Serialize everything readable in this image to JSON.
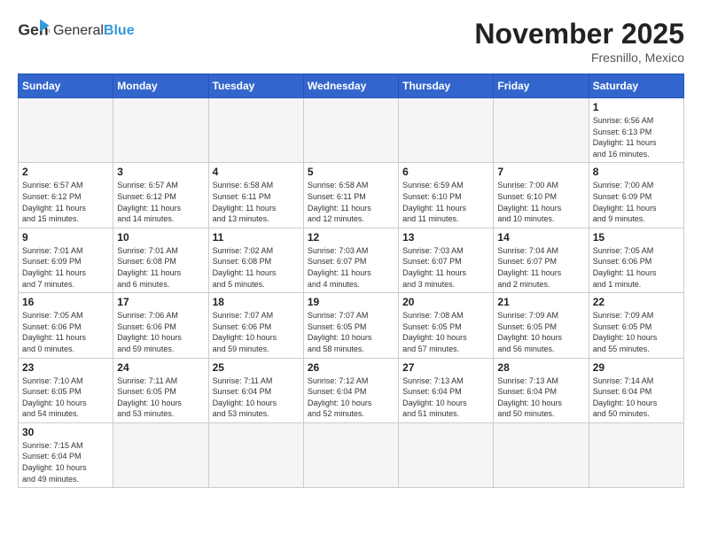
{
  "header": {
    "logo_general": "General",
    "logo_blue": "Blue",
    "month_title": "November 2025",
    "location": "Fresnillo, Mexico"
  },
  "days_of_week": [
    "Sunday",
    "Monday",
    "Tuesday",
    "Wednesday",
    "Thursday",
    "Friday",
    "Saturday"
  ],
  "weeks": [
    [
      {
        "day": "",
        "info": ""
      },
      {
        "day": "",
        "info": ""
      },
      {
        "day": "",
        "info": ""
      },
      {
        "day": "",
        "info": ""
      },
      {
        "day": "",
        "info": ""
      },
      {
        "day": "",
        "info": ""
      },
      {
        "day": "1",
        "info": "Sunrise: 6:56 AM\nSunset: 6:13 PM\nDaylight: 11 hours\nand 16 minutes."
      }
    ],
    [
      {
        "day": "2",
        "info": "Sunrise: 6:57 AM\nSunset: 6:12 PM\nDaylight: 11 hours\nand 15 minutes."
      },
      {
        "day": "3",
        "info": "Sunrise: 6:57 AM\nSunset: 6:12 PM\nDaylight: 11 hours\nand 14 minutes."
      },
      {
        "day": "4",
        "info": "Sunrise: 6:58 AM\nSunset: 6:11 PM\nDaylight: 11 hours\nand 13 minutes."
      },
      {
        "day": "5",
        "info": "Sunrise: 6:58 AM\nSunset: 6:11 PM\nDaylight: 11 hours\nand 12 minutes."
      },
      {
        "day": "6",
        "info": "Sunrise: 6:59 AM\nSunset: 6:10 PM\nDaylight: 11 hours\nand 11 minutes."
      },
      {
        "day": "7",
        "info": "Sunrise: 7:00 AM\nSunset: 6:10 PM\nDaylight: 11 hours\nand 10 minutes."
      },
      {
        "day": "8",
        "info": "Sunrise: 7:00 AM\nSunset: 6:09 PM\nDaylight: 11 hours\nand 9 minutes."
      }
    ],
    [
      {
        "day": "9",
        "info": "Sunrise: 7:01 AM\nSunset: 6:09 PM\nDaylight: 11 hours\nand 7 minutes."
      },
      {
        "day": "10",
        "info": "Sunrise: 7:01 AM\nSunset: 6:08 PM\nDaylight: 11 hours\nand 6 minutes."
      },
      {
        "day": "11",
        "info": "Sunrise: 7:02 AM\nSunset: 6:08 PM\nDaylight: 11 hours\nand 5 minutes."
      },
      {
        "day": "12",
        "info": "Sunrise: 7:03 AM\nSunset: 6:07 PM\nDaylight: 11 hours\nand 4 minutes."
      },
      {
        "day": "13",
        "info": "Sunrise: 7:03 AM\nSunset: 6:07 PM\nDaylight: 11 hours\nand 3 minutes."
      },
      {
        "day": "14",
        "info": "Sunrise: 7:04 AM\nSunset: 6:07 PM\nDaylight: 11 hours\nand 2 minutes."
      },
      {
        "day": "15",
        "info": "Sunrise: 7:05 AM\nSunset: 6:06 PM\nDaylight: 11 hours\nand 1 minute."
      }
    ],
    [
      {
        "day": "16",
        "info": "Sunrise: 7:05 AM\nSunset: 6:06 PM\nDaylight: 11 hours\nand 0 minutes."
      },
      {
        "day": "17",
        "info": "Sunrise: 7:06 AM\nSunset: 6:06 PM\nDaylight: 10 hours\nand 59 minutes."
      },
      {
        "day": "18",
        "info": "Sunrise: 7:07 AM\nSunset: 6:06 PM\nDaylight: 10 hours\nand 59 minutes."
      },
      {
        "day": "19",
        "info": "Sunrise: 7:07 AM\nSunset: 6:05 PM\nDaylight: 10 hours\nand 58 minutes."
      },
      {
        "day": "20",
        "info": "Sunrise: 7:08 AM\nSunset: 6:05 PM\nDaylight: 10 hours\nand 57 minutes."
      },
      {
        "day": "21",
        "info": "Sunrise: 7:09 AM\nSunset: 6:05 PM\nDaylight: 10 hours\nand 56 minutes."
      },
      {
        "day": "22",
        "info": "Sunrise: 7:09 AM\nSunset: 6:05 PM\nDaylight: 10 hours\nand 55 minutes."
      }
    ],
    [
      {
        "day": "23",
        "info": "Sunrise: 7:10 AM\nSunset: 6:05 PM\nDaylight: 10 hours\nand 54 minutes."
      },
      {
        "day": "24",
        "info": "Sunrise: 7:11 AM\nSunset: 6:05 PM\nDaylight: 10 hours\nand 53 minutes."
      },
      {
        "day": "25",
        "info": "Sunrise: 7:11 AM\nSunset: 6:04 PM\nDaylight: 10 hours\nand 53 minutes."
      },
      {
        "day": "26",
        "info": "Sunrise: 7:12 AM\nSunset: 6:04 PM\nDaylight: 10 hours\nand 52 minutes."
      },
      {
        "day": "27",
        "info": "Sunrise: 7:13 AM\nSunset: 6:04 PM\nDaylight: 10 hours\nand 51 minutes."
      },
      {
        "day": "28",
        "info": "Sunrise: 7:13 AM\nSunset: 6:04 PM\nDaylight: 10 hours\nand 50 minutes."
      },
      {
        "day": "29",
        "info": "Sunrise: 7:14 AM\nSunset: 6:04 PM\nDaylight: 10 hours\nand 50 minutes."
      }
    ],
    [
      {
        "day": "30",
        "info": "Sunrise: 7:15 AM\nSunset: 6:04 PM\nDaylight: 10 hours\nand 49 minutes."
      },
      {
        "day": "",
        "info": ""
      },
      {
        "day": "",
        "info": ""
      },
      {
        "day": "",
        "info": ""
      },
      {
        "day": "",
        "info": ""
      },
      {
        "day": "",
        "info": ""
      },
      {
        "day": "",
        "info": ""
      }
    ]
  ]
}
